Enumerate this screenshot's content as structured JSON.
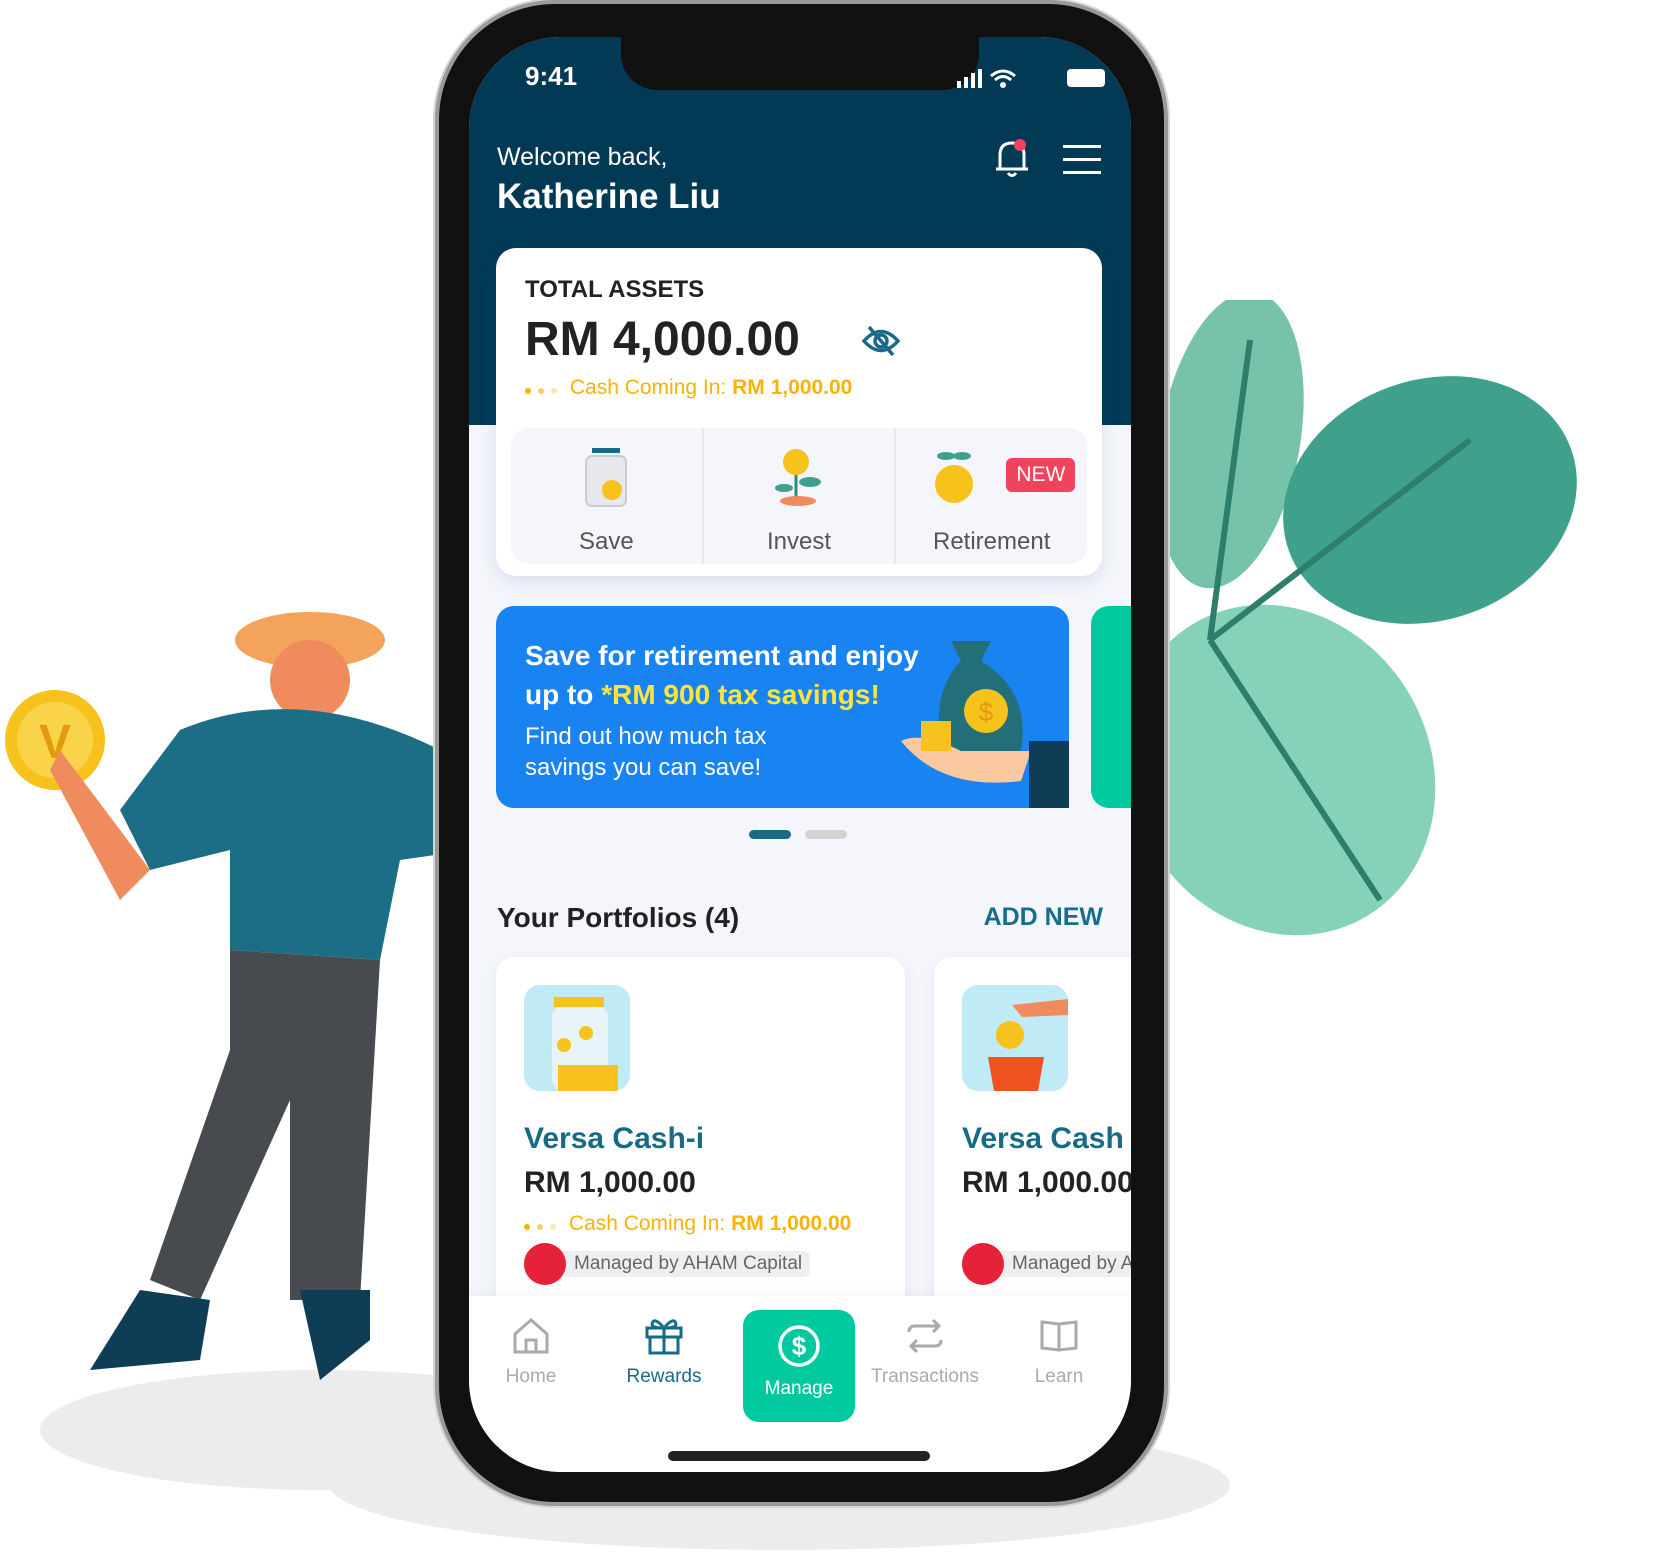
{
  "status_bar": {
    "time": "9:41"
  },
  "header": {
    "greeting": "Welcome back,",
    "user_name": "Katherine Liu"
  },
  "total_assets": {
    "label": "TOTAL ASSETS",
    "value": "RM 4,000.00",
    "cash_coming_label": "Cash Coming In:",
    "cash_coming_value": "RM 1,000.00"
  },
  "quick_actions": [
    {
      "label": "Save",
      "icon": "jar-icon"
    },
    {
      "label": "Invest",
      "icon": "plant-coin-icon"
    },
    {
      "label": "Retirement",
      "icon": "fruit-coin-icon",
      "badge": "NEW"
    }
  ],
  "banner": {
    "title_part1": "Save for retirement and enjoy up to ",
    "title_highlight": "*RM 900 tax savings!",
    "subtitle": "Find out how much tax savings you can save!",
    "page": 1,
    "pages": 2
  },
  "portfolios": {
    "title": "Your Portfolios (4)",
    "add_new": "ADD NEW",
    "items": [
      {
        "name": "Versa Cash-i",
        "value": "RM 1,000.00",
        "cash_coming_label": "Cash Coming In:",
        "cash_coming_value": "RM 1,000.00",
        "manager": "Managed by AHAM Capital"
      },
      {
        "name": "Versa Cash",
        "value": "RM 1,000.00",
        "manager": "Managed by AHAM Capital"
      }
    ]
  },
  "tabbar": {
    "items": [
      {
        "label": "Home"
      },
      {
        "label": "Rewards"
      },
      {
        "label": "Manage"
      },
      {
        "label": "Transactions"
      },
      {
        "label": "Learn"
      }
    ],
    "active": "Manage"
  },
  "colors": {
    "header": "#023a56",
    "accent": "#00c9a0",
    "banner": "#1a83f2",
    "highlight": "#f9b300",
    "badge": "#f0435d"
  }
}
